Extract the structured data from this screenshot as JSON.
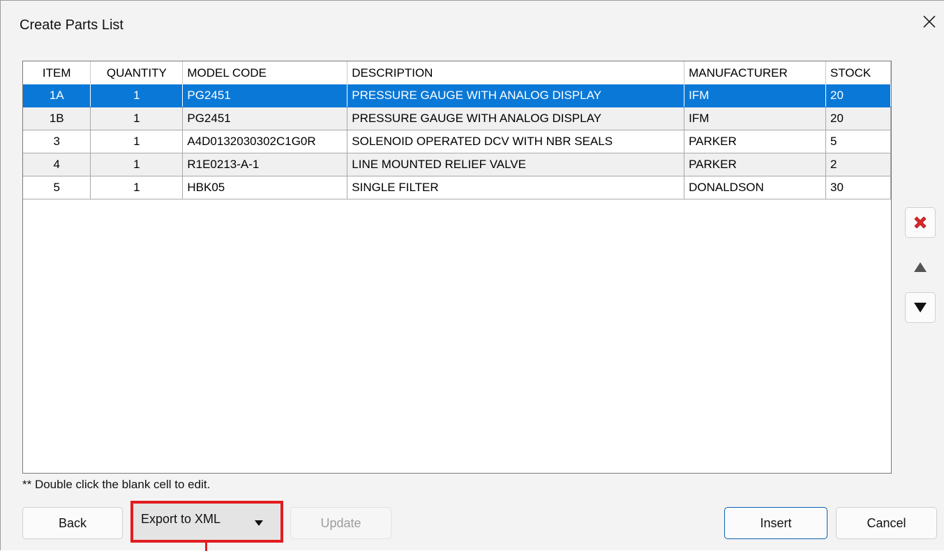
{
  "window": {
    "title": "Create Parts List"
  },
  "icons": {
    "close": "close-icon",
    "delete": "delete-x-icon",
    "up": "triangle-up-icon",
    "down": "triangle-down-icon",
    "dropdown": "caret-down-icon"
  },
  "colors": {
    "selection": "#0a78d7",
    "delete_icon": "#e0262a",
    "highlight_box": "#e21d20"
  },
  "table": {
    "columns": [
      "ITEM",
      "QUANTITY",
      "MODEL CODE",
      "DESCRIPTION",
      "MANUFACTURER",
      "STOCK"
    ],
    "rows": [
      {
        "item": "1A",
        "quantity": "1",
        "model_code": "PG2451",
        "description": "PRESSURE GAUGE WITH ANALOG DISPLAY",
        "manufacturer": "IFM",
        "stock": "20",
        "selected": true
      },
      {
        "item": "1B",
        "quantity": "1",
        "model_code": "PG2451",
        "description": "PRESSURE GAUGE WITH ANALOG DISPLAY",
        "manufacturer": "IFM",
        "stock": "20",
        "selected": false
      },
      {
        "item": "3",
        "quantity": "1",
        "model_code": "A4D0132030302C1G0R",
        "description": "SOLENOID OPERATED DCV WITH NBR SEALS",
        "manufacturer": "PARKER",
        "stock": "5",
        "selected": false
      },
      {
        "item": "4",
        "quantity": "1",
        "model_code": "R1E0213-A-1",
        "description": "LINE MOUNTED RELIEF VALVE",
        "manufacturer": "PARKER",
        "stock": "2",
        "selected": false
      },
      {
        "item": "5",
        "quantity": "1",
        "model_code": "HBK05",
        "description": "SINGLE FILTER",
        "manufacturer": "DONALDSON",
        "stock": "30",
        "selected": false
      }
    ]
  },
  "hint": "** Double click the blank cell to edit.",
  "buttons": {
    "back": "Back",
    "export": "Export to XML",
    "update": "Update",
    "insert": "Insert",
    "cancel": "Cancel"
  }
}
